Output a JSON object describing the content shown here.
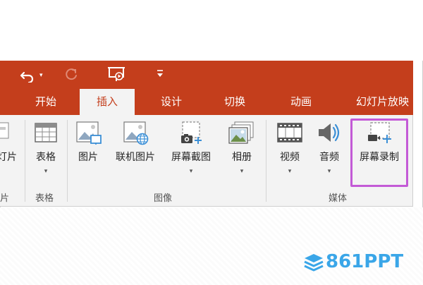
{
  "tabs": [
    {
      "label": "开始",
      "active": false
    },
    {
      "label": "插入",
      "active": true
    },
    {
      "label": "设计",
      "active": false
    },
    {
      "label": "切换",
      "active": false
    },
    {
      "label": "动画",
      "active": false
    },
    {
      "label": "幻灯片放映",
      "active": false
    }
  ],
  "ribbon": {
    "partial_button_label": "灯片",
    "partial_group_label": "片",
    "buttons": {
      "table": "表格",
      "picture": "图片",
      "online_picture": "联机图片",
      "screenshot": "屏幕截图",
      "album": "相册",
      "video": "视频",
      "audio": "音频",
      "screen_record": "屏幕录制"
    },
    "groups": {
      "tables": "表格",
      "images": "图像",
      "media": "媒体"
    }
  },
  "watermark": {
    "text": "861PPT"
  },
  "colors": {
    "ribbon_red": "#c43e1c",
    "highlight": "#c35ad6",
    "watermark": "#3aa6e8"
  },
  "icons": [
    "undo-icon",
    "redo-icon",
    "present-from-start-icon",
    "customize-qat-icon",
    "table-icon",
    "picture-icon",
    "online-picture-icon",
    "screenshot-icon",
    "album-icon",
    "video-icon",
    "audio-icon",
    "screen-record-icon"
  ]
}
